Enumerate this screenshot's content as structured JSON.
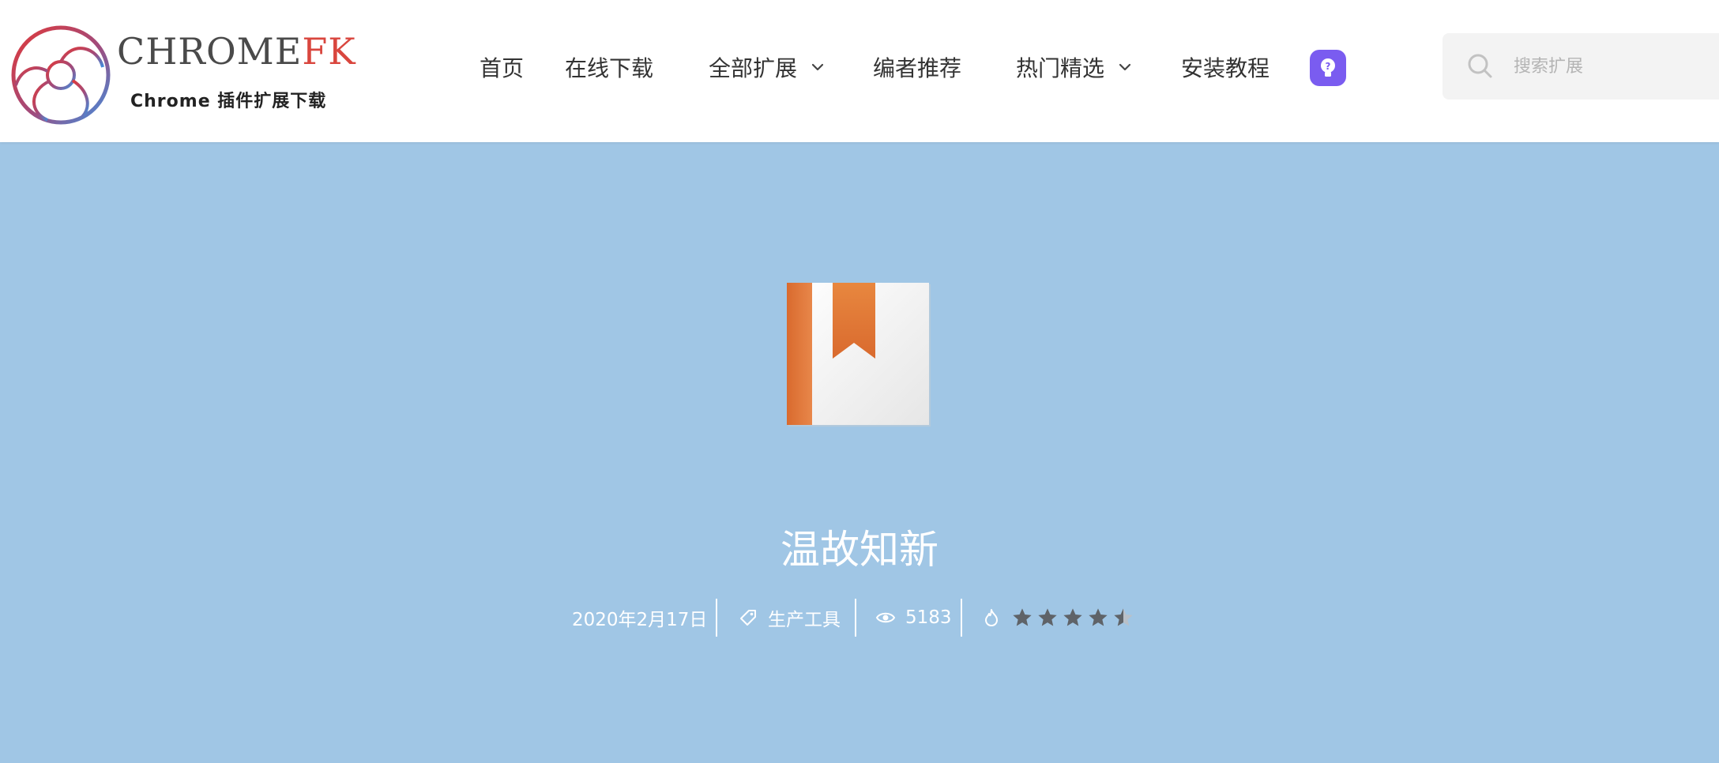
{
  "brand": {
    "word_main": "CHROME",
    "word_accent": "FK",
    "subtitle": "Chrome 插件扩展下载"
  },
  "nav": {
    "items": [
      {
        "label": "首页",
        "has_dropdown": false
      },
      {
        "label": "在线下载",
        "has_dropdown": false
      },
      {
        "label": "全部扩展",
        "has_dropdown": true
      },
      {
        "label": "编者推荐",
        "has_dropdown": false
      },
      {
        "label": "热门精选",
        "has_dropdown": true
      },
      {
        "label": "安装教程",
        "has_dropdown": false
      }
    ],
    "tips_icon": "lightbulb-icon"
  },
  "search": {
    "placeholder": "搜索扩展",
    "value": ""
  },
  "extension": {
    "name": "温故知新",
    "date": "2020年2月17日",
    "category": "生产工具",
    "views": "5183",
    "rating_stars": 4.5,
    "rating_max": 5
  },
  "colors": {
    "hero_bg": "#a0c6e5",
    "accent_red": "#d9463e",
    "tips_purple": "#7a5cf0",
    "star_gray": "#5f6368"
  }
}
